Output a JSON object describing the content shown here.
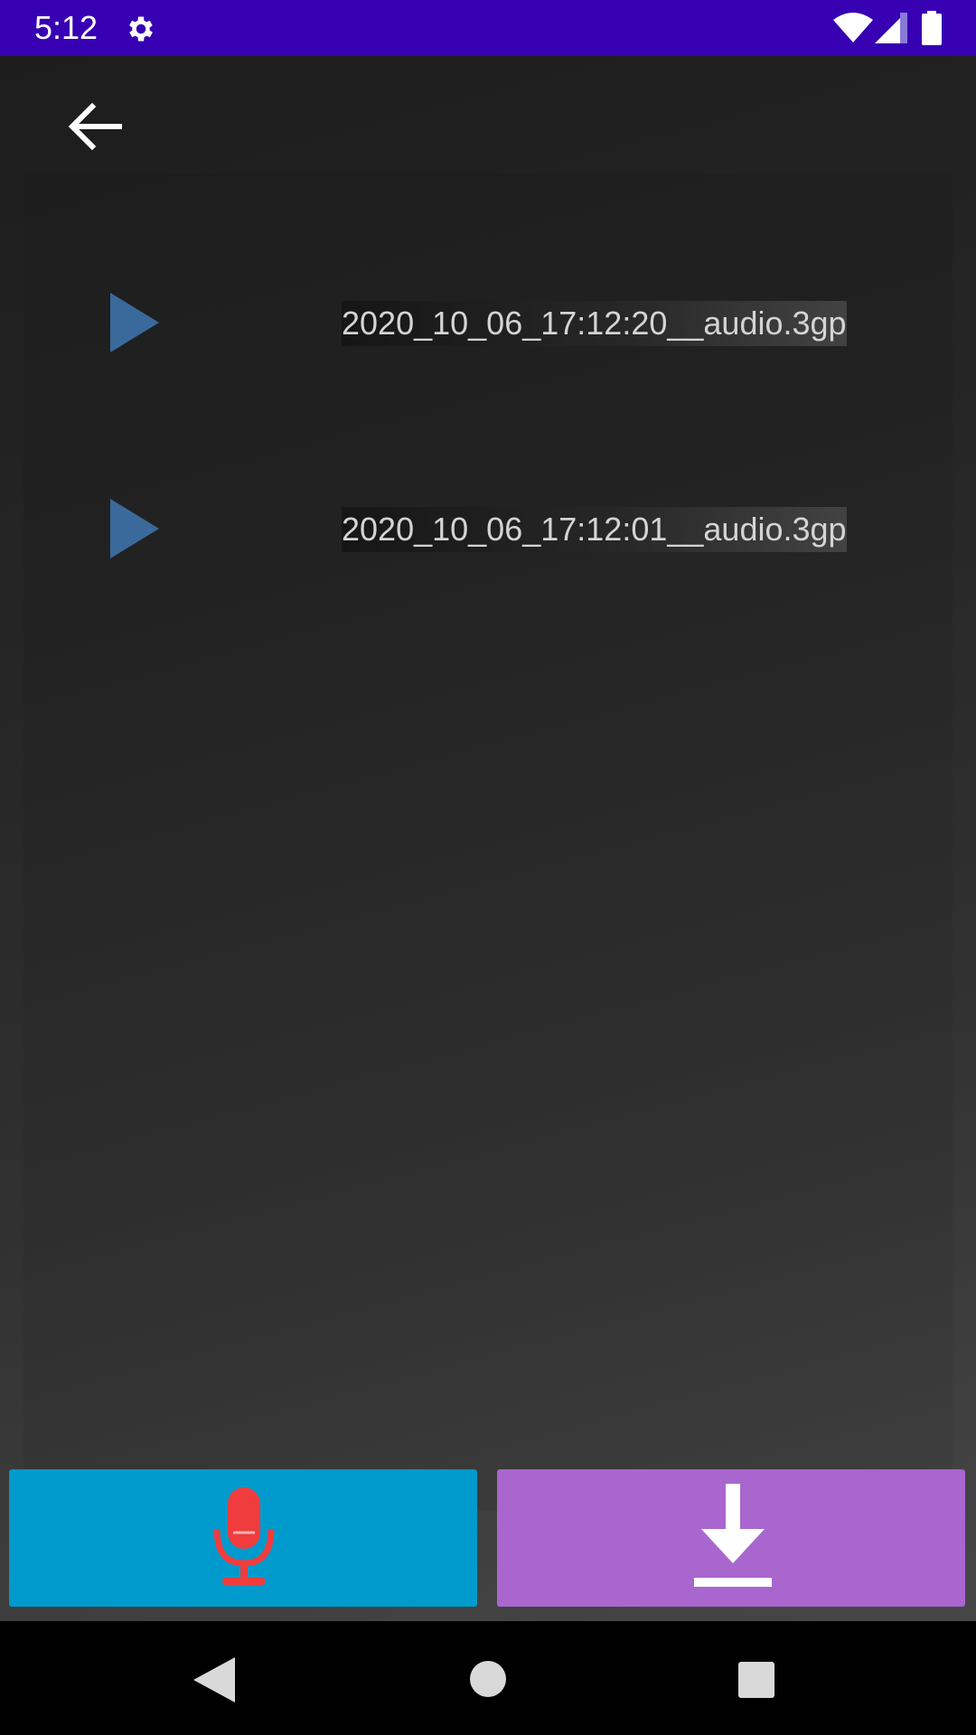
{
  "status_bar": {
    "time": "5:12",
    "icons": [
      "gear-icon",
      "wifi-icon",
      "signal-icon",
      "battery-icon"
    ],
    "background": "#3700b3"
  },
  "toolbar": {
    "back_icon": "arrow-left-icon"
  },
  "recordings": [
    {
      "file_name": "2020_10_06_17:12:20__audio.3gp",
      "icon": "play-icon"
    },
    {
      "file_name": "2020_10_06_17:12:01__audio.3gp",
      "icon": "play-icon"
    }
  ],
  "actions": {
    "record": {
      "icon": "microphone-icon",
      "color": "#009acd",
      "icon_color": "#f03c3c"
    },
    "download": {
      "icon": "download-icon",
      "color": "#a966cf"
    }
  },
  "navigation": {
    "icons": [
      "nav-back-icon",
      "nav-home-icon",
      "nav-recents-icon"
    ]
  },
  "colors": {
    "play_icon": "#3a6a9c",
    "file_text": "#d4d4d4"
  }
}
